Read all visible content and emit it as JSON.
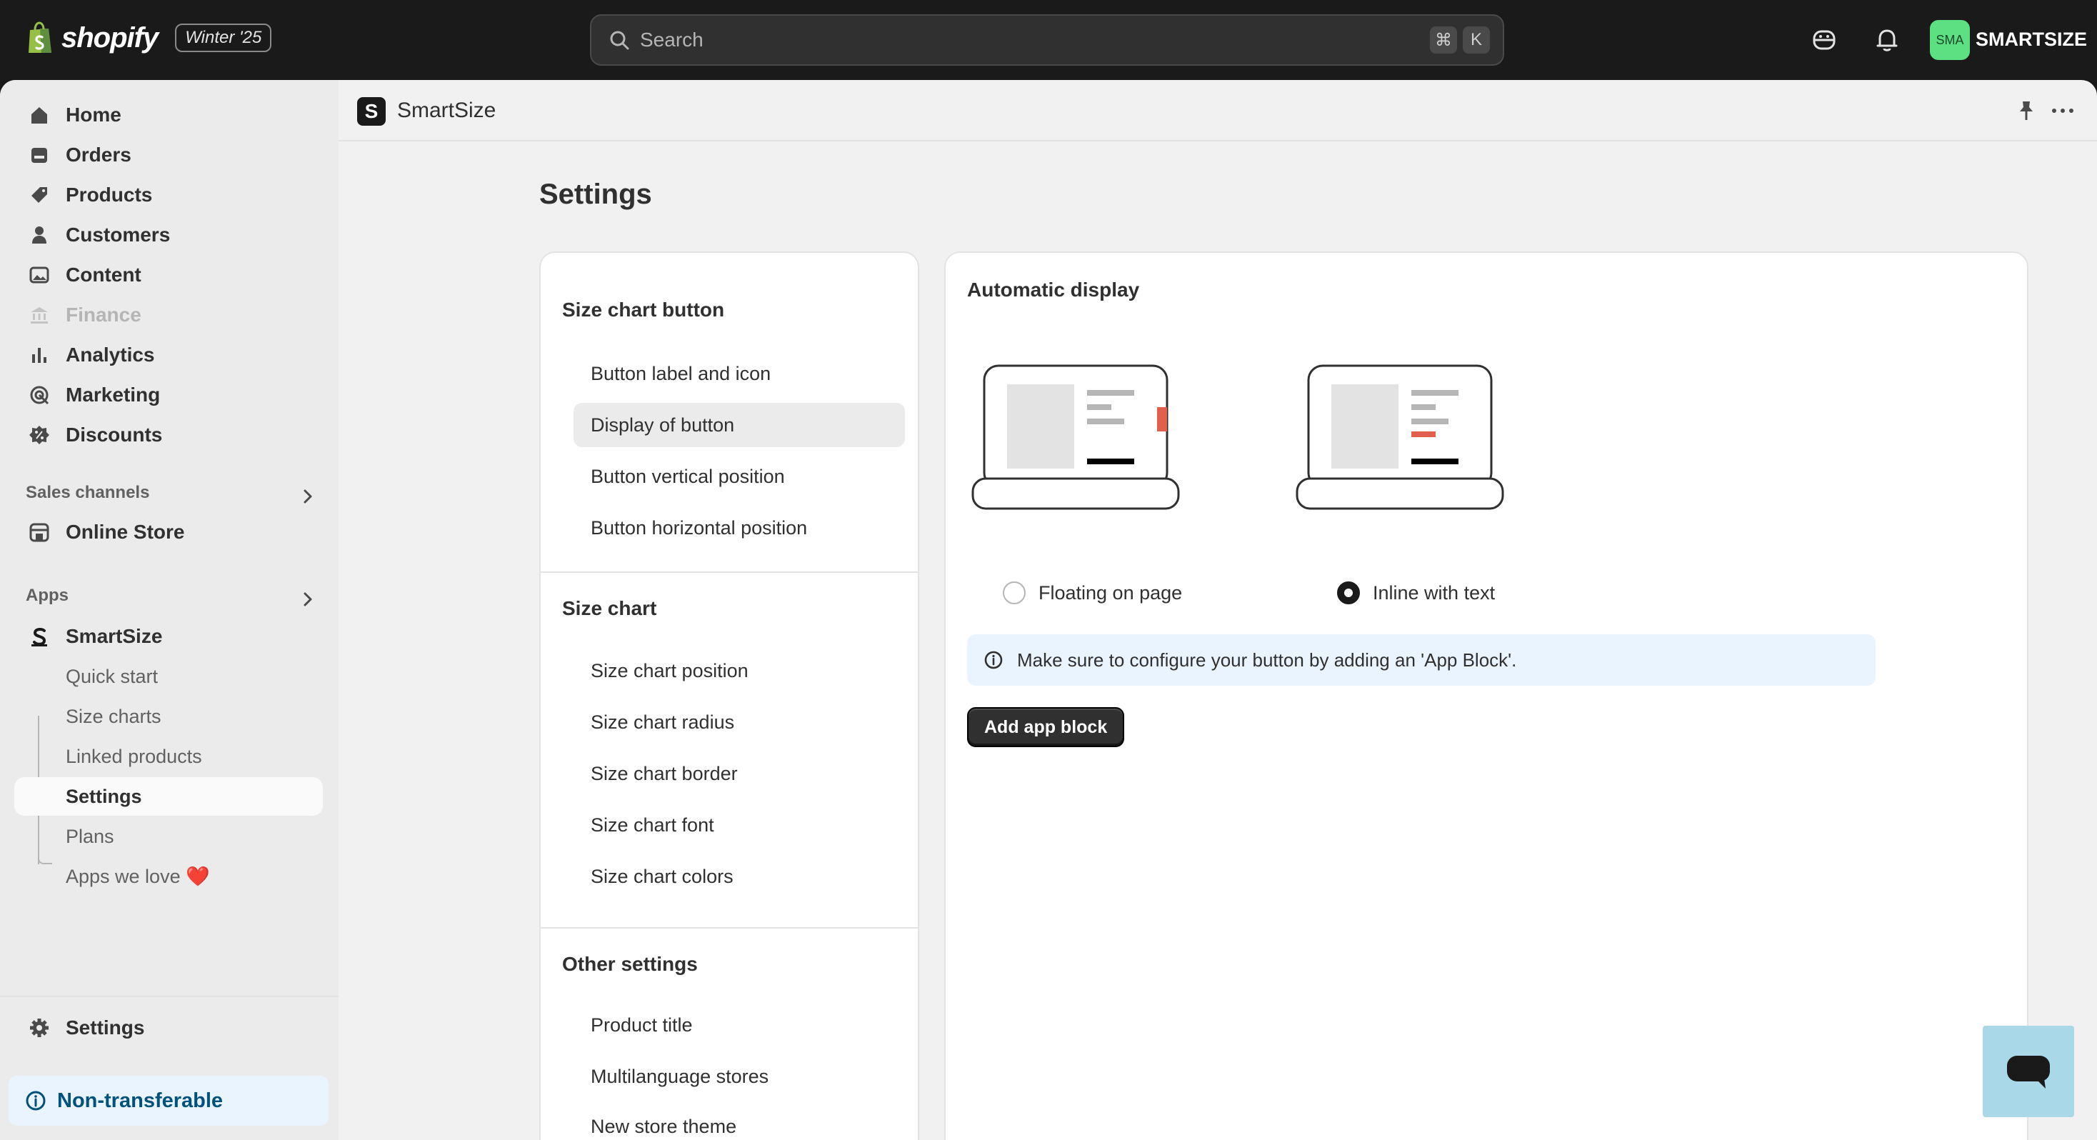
{
  "topbar": {
    "logo_text": "shopify",
    "version_badge": "Winter '25",
    "search_placeholder": "Search",
    "shortcut_keys": [
      "⌘",
      "K"
    ],
    "avatar_initials": "SMA",
    "store_name": "SMARTSIZE"
  },
  "sidebar": {
    "main_items": [
      {
        "label": "Home",
        "icon": "home-icon"
      },
      {
        "label": "Orders",
        "icon": "orders-icon"
      },
      {
        "label": "Products",
        "icon": "tag-icon"
      },
      {
        "label": "Customers",
        "icon": "person-icon"
      },
      {
        "label": "Content",
        "icon": "image-icon"
      },
      {
        "label": "Finance",
        "icon": "bank-icon",
        "disabled": true
      },
      {
        "label": "Analytics",
        "icon": "bar-chart-icon"
      },
      {
        "label": "Marketing",
        "icon": "target-icon"
      },
      {
        "label": "Discounts",
        "icon": "discount-icon"
      }
    ],
    "sales_channels_label": "Sales channels",
    "online_store_label": "Online Store",
    "apps_label": "Apps",
    "app_name": "SmartSize",
    "app_sub_items": [
      {
        "label": "Quick start"
      },
      {
        "label": "Size charts"
      },
      {
        "label": "Linked products"
      },
      {
        "label": "Settings",
        "active": true
      },
      {
        "label": "Plans"
      },
      {
        "label": "Apps we love ❤️"
      }
    ],
    "settings_label": "Settings",
    "notice_label": "Non-transferable"
  },
  "app_header": {
    "title": "SmartSize",
    "logo_letter": "S"
  },
  "page": {
    "title": "Settings"
  },
  "settings_nav": {
    "groups": [
      {
        "heading": "Size chart button",
        "items": [
          "Button label and icon",
          "Display of button",
          "Button vertical position",
          "Button horizontal position"
        ]
      },
      {
        "heading": "Size chart",
        "items": [
          "Size chart position",
          "Size chart radius",
          "Size chart border",
          "Size chart font",
          "Size chart colors"
        ]
      },
      {
        "heading": "Other settings",
        "items": [
          "Product title",
          "Multilanguage stores",
          "New store theme"
        ]
      }
    ],
    "active_item": "Display of button"
  },
  "display_panel": {
    "heading": "Automatic display",
    "options": [
      {
        "label": "Floating on page",
        "checked": false
      },
      {
        "label": "Inline with text",
        "checked": true
      }
    ],
    "info_text": "Make sure to configure your button by adding an 'App Block'.",
    "add_button_label": "Add app block"
  },
  "colors": {
    "accent_red": "#e0604d",
    "avatar_green": "#5ce082",
    "notice_blue": "#00527c"
  }
}
